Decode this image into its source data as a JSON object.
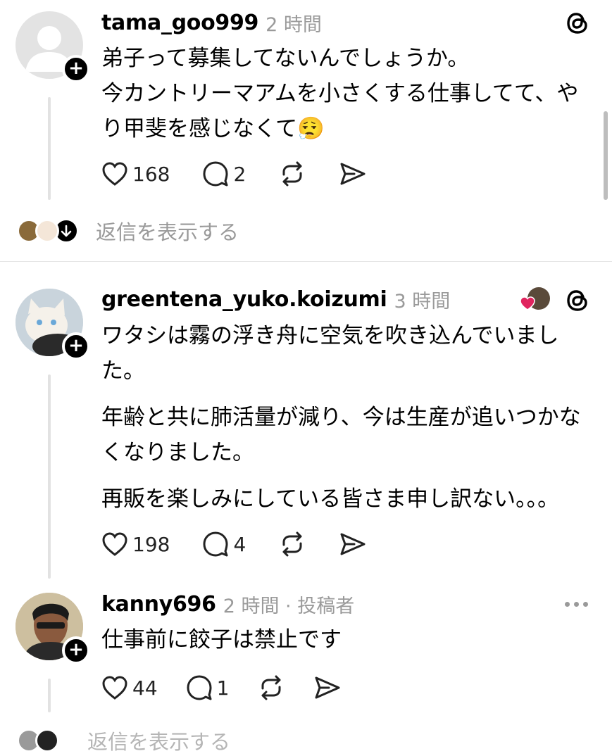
{
  "posts": [
    {
      "username": "tama_goo999",
      "time": "2 時間",
      "paragraphs": [
        "弟子って募集してないんでしょうか。",
        "今カントリーマアムを小さくする仕事してて、やり甲斐を感じなくて😮‍💨"
      ],
      "likes": "168",
      "replies": "2"
    },
    {
      "username": "greentena_yuko.koizumi",
      "time": "3 時間",
      "paragraphs": [
        "ワタシは霧の浮き舟に空気を吹き込んでいました。",
        "年齢と共に肺活量が減り、今は生産が追いつかなくなりました。",
        "再販を楽しみにしている皆さま申し訳ない。。。"
      ],
      "likes": "198",
      "replies": "4"
    },
    {
      "username": "kanny696",
      "time": "2 時間 · 投稿者",
      "paragraphs": [
        "仕事前に餃子は禁止です"
      ],
      "likes": "44",
      "replies": "1"
    }
  ],
  "show_replies_label": "返信を表示する",
  "show_replies_label_partial": "返信を表示する",
  "colors": {
    "muted": "#9a9a9a",
    "heart_liked": "#e0245e",
    "line": "#e2e2e2"
  },
  "icons": [
    "threads-icon",
    "heart-icon",
    "comment-icon",
    "repost-icon",
    "share-icon",
    "more-icon",
    "arrow-down-icon",
    "plus-icon"
  ]
}
